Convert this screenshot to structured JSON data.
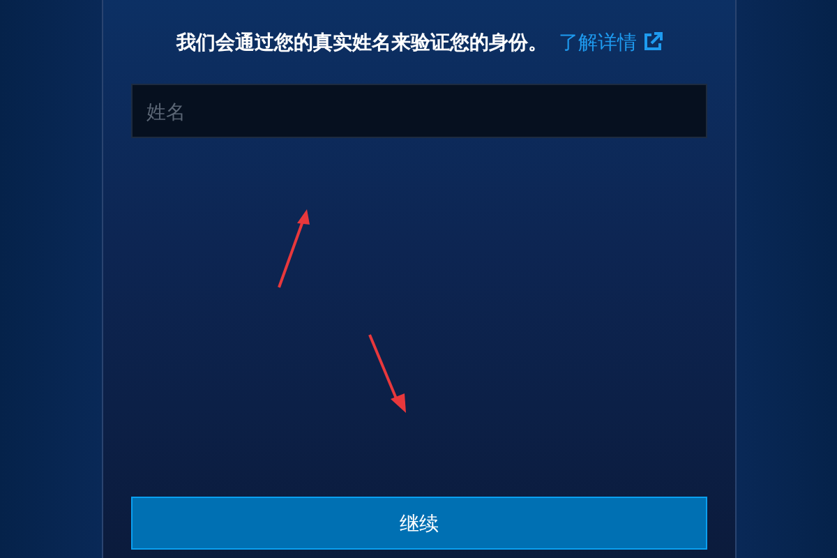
{
  "message": {
    "text": "我们会通过您的真实姓名来验证您的身份。",
    "link": "了解详情"
  },
  "name_field": {
    "placeholder": "姓名"
  },
  "continue_button": {
    "label": "继续"
  }
}
